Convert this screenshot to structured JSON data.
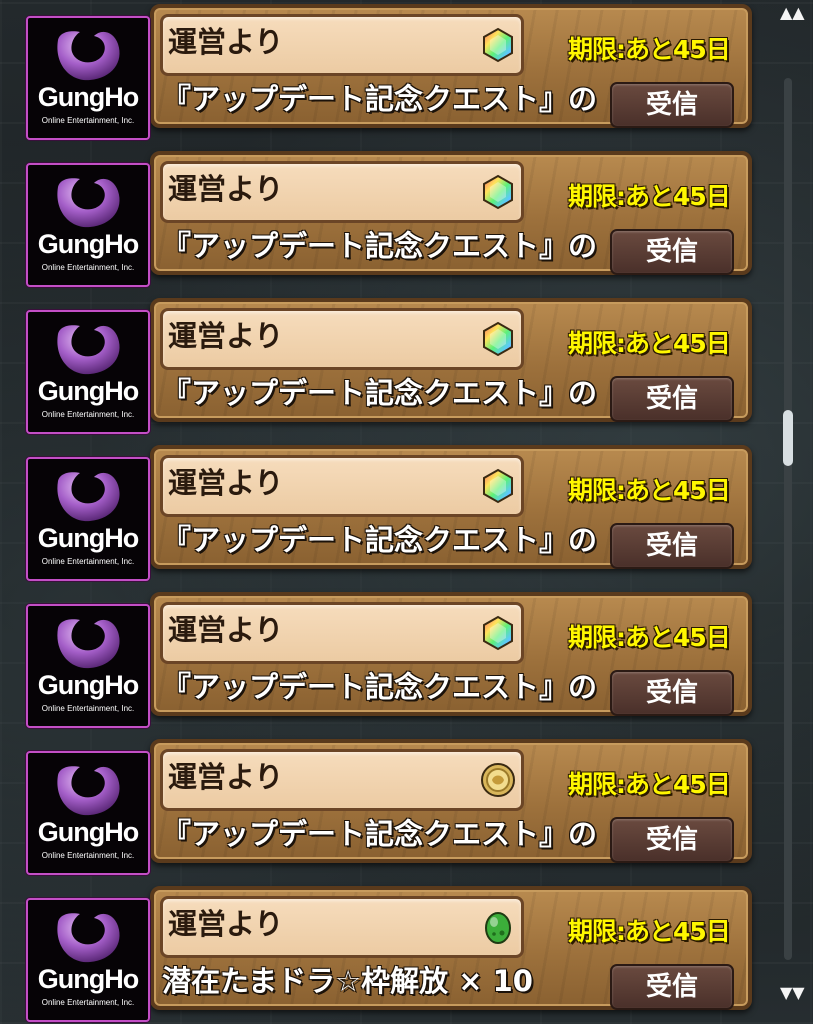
{
  "mail": {
    "items": [
      {
        "sender": "運営より",
        "expiry": "期限:あと45日",
        "message": "『アップデート記念クエスト』の",
        "button": "受信",
        "reward_icon": "rainbow-gem-icon"
      },
      {
        "sender": "運営より",
        "expiry": "期限:あと45日",
        "message": "『アップデート記念クエスト』の",
        "button": "受信",
        "reward_icon": "rainbow-gem-icon"
      },
      {
        "sender": "運営より",
        "expiry": "期限:あと45日",
        "message": "『アップデート記念クエスト』の",
        "button": "受信",
        "reward_icon": "rainbow-gem-icon"
      },
      {
        "sender": "運営より",
        "expiry": "期限:あと45日",
        "message": "『アップデート記念クエスト』の",
        "button": "受信",
        "reward_icon": "rainbow-gem-icon"
      },
      {
        "sender": "運営より",
        "expiry": "期限:あと45日",
        "message": "『アップデート記念クエスト』の",
        "button": "受信",
        "reward_icon": "rainbow-gem-icon"
      },
      {
        "sender": "運営より",
        "expiry": "期限:あと45日",
        "message": "『アップデート記念クエスト』の",
        "button": "受信",
        "reward_icon": "gold-coin-icon"
      },
      {
        "sender": "運営より",
        "expiry": "期限:あと45日",
        "message": "潜在たまドラ☆枠解放 × 10",
        "button": "受信",
        "reward_icon": "green-egg-icon"
      }
    ]
  },
  "brand": {
    "name": "GungHo",
    "subtitle": "Online Entertainment, Inc."
  },
  "scrollbar": {
    "up_icon": "double-up-arrow-icon",
    "down_icon": "double-down-arrow-icon",
    "up_symbol": "▲▲",
    "down_symbol": "▼▼"
  },
  "colors": {
    "card": "#a57a43",
    "expiry_text": "#fff700",
    "avatar_border": "#c34fc6",
    "logo_purple": "#9b5bbf",
    "button": "#4a302a"
  }
}
